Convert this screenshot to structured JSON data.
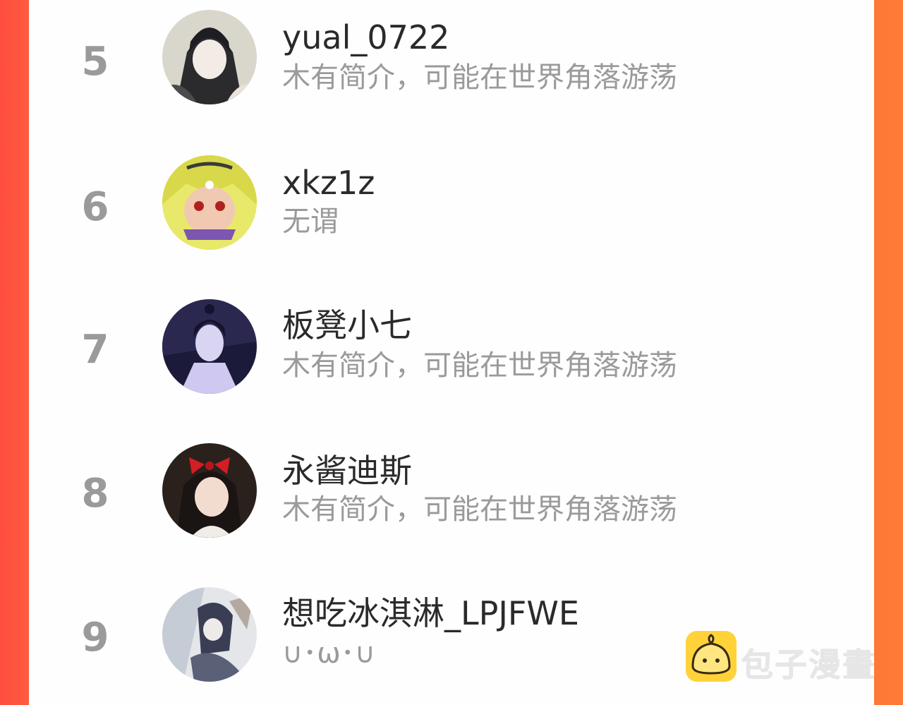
{
  "ranking": [
    {
      "rank": "5",
      "name": "yual_0722",
      "bio": "木有简介，可能在世界角落游荡"
    },
    {
      "rank": "6",
      "name": "xkz1z",
      "bio": "无谓"
    },
    {
      "rank": "7",
      "name": "板凳小七",
      "bio": "木有简介，可能在世界角落游荡"
    },
    {
      "rank": "8",
      "name": "永酱迪斯",
      "bio": "木有简介，可能在世界角落游荡"
    },
    {
      "rank": "9",
      "name": "想吃冰淇淋_LPJFWE",
      "bio": "∪･ω･∪"
    }
  ],
  "watermark": {
    "text": "包子漫畫"
  },
  "colors": {
    "background_accent": "#ff5a3f",
    "rank": "#9a9a9a",
    "name": "#2a2a2a",
    "bio": "#9a9a9a",
    "watermark_icon": "#ffd23a"
  }
}
